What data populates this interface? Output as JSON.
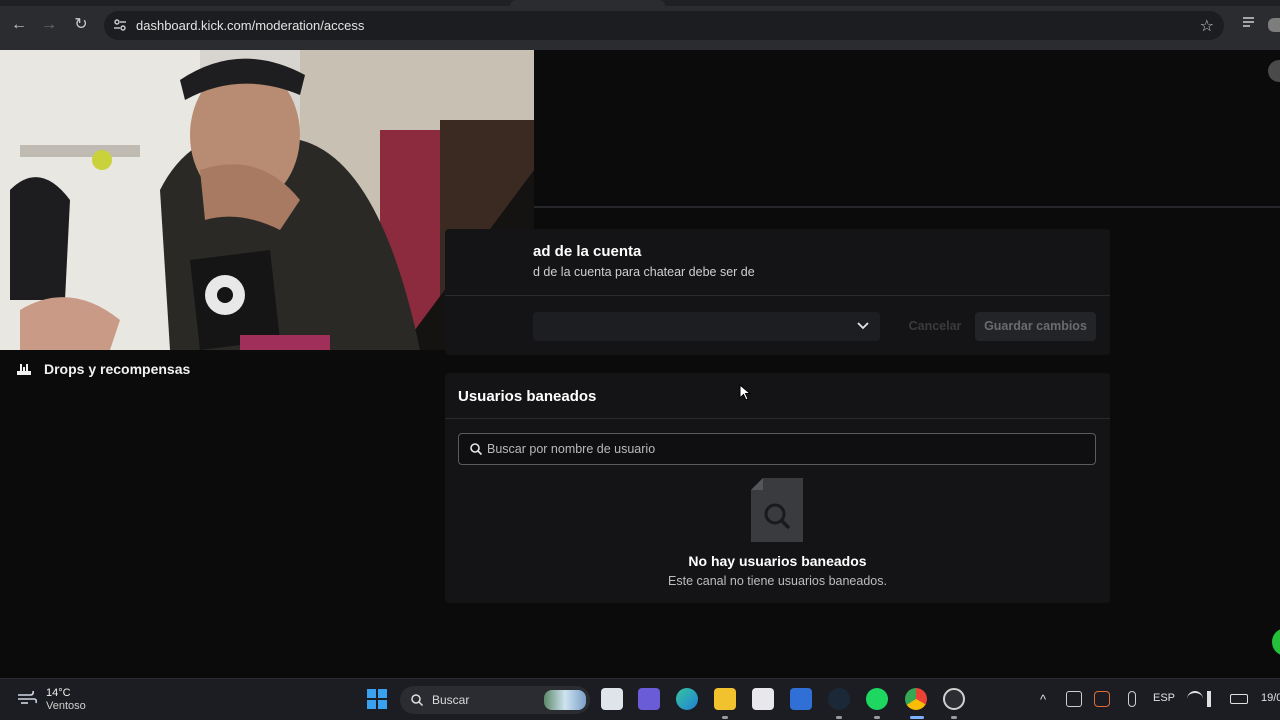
{
  "browser": {
    "url": "dashboard.kick.com/moderation/access"
  },
  "sidebar": {
    "items": [
      {
        "label": "Drops y recompensas",
        "icon": "gift-drops-icon"
      }
    ]
  },
  "account_age": {
    "title": "ad de la cuenta",
    "description": "d de la cuenta para chatear debe ser de",
    "cancel_label": "Cancelar",
    "save_label": "Guardar cambios"
  },
  "banned_users": {
    "title": "Usuarios baneados",
    "search_placeholder": "Buscar por nombre de usuario",
    "empty_title": "No hay usuarios baneados",
    "empty_subtitle": "Este canal no tiene usuarios baneados."
  },
  "taskbar": {
    "weather_temp": "14°C",
    "weather_condition": "Ventoso",
    "search_label": "Buscar",
    "language": "ESP",
    "date_partial": "19/0"
  },
  "colors": {
    "kick_green": "#24c03a",
    "page_bg": "#0b0b0c",
    "card_bg": "#141416"
  }
}
